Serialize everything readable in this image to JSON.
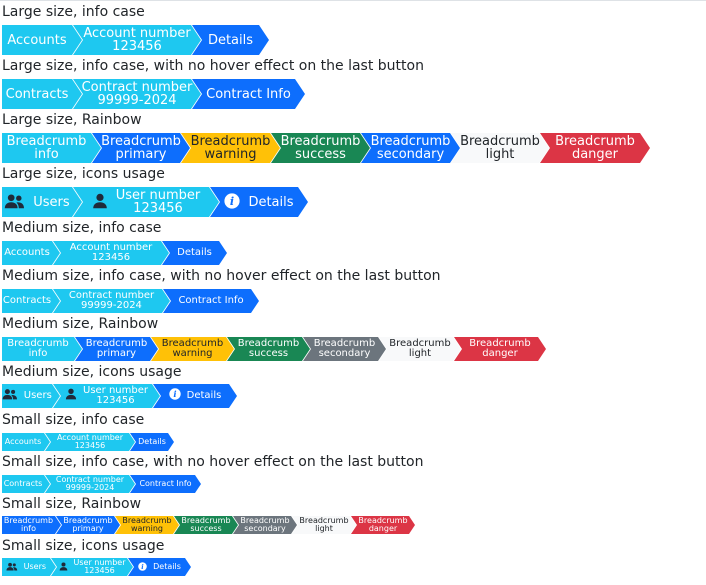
{
  "colors": {
    "info": "#1ec8f0",
    "primary": "#0d6efd",
    "warning": "#ffc107",
    "success": "#198754",
    "secondary": "#6c757d",
    "light": "#f8f9fa",
    "danger": "#dc3545",
    "dark_text": "#212529",
    "white_text": "#ffffff"
  },
  "sections": [
    {
      "heading": "Large size, info case",
      "items": [
        {
          "lines": [
            "Accounts"
          ],
          "color": "info"
        },
        {
          "lines": [
            "Account number",
            "123456"
          ],
          "color": "info"
        },
        {
          "lines": [
            "Details"
          ],
          "color": "primary"
        }
      ]
    },
    {
      "heading": "Large size, info case, with no hover effect on the last button",
      "items": [
        {
          "lines": [
            "Contracts"
          ],
          "color": "info"
        },
        {
          "lines": [
            "Contract number",
            "99999-2024"
          ],
          "color": "info"
        },
        {
          "lines": [
            "Contract Info"
          ],
          "color": "primary"
        }
      ]
    },
    {
      "heading": "Large size, Rainbow",
      "items": [
        {
          "lines": [
            "Breadcrumb",
            "info"
          ],
          "color": "info"
        },
        {
          "lines": [
            "Breadcrumb",
            "primary"
          ],
          "color": "primary"
        },
        {
          "lines": [
            "Breadcrumb",
            "warning"
          ],
          "color": "warning"
        },
        {
          "lines": [
            "Breadcrumb",
            "success"
          ],
          "color": "success"
        },
        {
          "lines": [
            "Breadcrumb",
            "secondary"
          ],
          "color": "primary"
        },
        {
          "lines": [
            "Breadcrumb",
            "light"
          ],
          "color": "light"
        },
        {
          "lines": [
            "Breadcrumb",
            "danger"
          ],
          "color": "danger"
        }
      ]
    },
    {
      "heading": "Large size, icons usage",
      "items": [
        {
          "lines": [
            "Users"
          ],
          "color": "info",
          "icon": "users-icon"
        },
        {
          "lines": [
            "User number",
            "123456"
          ],
          "color": "info",
          "icon": "user-icon"
        },
        {
          "lines": [
            "Details"
          ],
          "color": "primary",
          "icon": "info-icon"
        }
      ]
    },
    {
      "heading": "Medium size, info case",
      "items": [
        {
          "lines": [
            "Accounts"
          ],
          "color": "info"
        },
        {
          "lines": [
            "Account number",
            "123456"
          ],
          "color": "info"
        },
        {
          "lines": [
            "Details"
          ],
          "color": "primary"
        }
      ]
    },
    {
      "heading": "Medium size, info case, with no hover effect on the last button",
      "items": [
        {
          "lines": [
            "Contracts"
          ],
          "color": "info"
        },
        {
          "lines": [
            "Contract number",
            "99999-2024"
          ],
          "color": "info"
        },
        {
          "lines": [
            "Contract Info"
          ],
          "color": "primary"
        }
      ]
    },
    {
      "heading": "Medium size, Rainbow",
      "items": [
        {
          "lines": [
            "Breadcrumb",
            "info"
          ],
          "color": "info"
        },
        {
          "lines": [
            "Breadcrumb",
            "primary"
          ],
          "color": "primary"
        },
        {
          "lines": [
            "Breadcrumb",
            "warning"
          ],
          "color": "warning"
        },
        {
          "lines": [
            "Breadcrumb",
            "success"
          ],
          "color": "success"
        },
        {
          "lines": [
            "Breadcrumb",
            "secondary"
          ],
          "color": "secondary"
        },
        {
          "lines": [
            "Breadcrumb",
            "light"
          ],
          "color": "light"
        },
        {
          "lines": [
            "Breadcrumb",
            "danger"
          ],
          "color": "danger"
        }
      ]
    },
    {
      "heading": "Medium size, icons usage",
      "items": [
        {
          "lines": [
            "Users"
          ],
          "color": "info",
          "icon": "users-icon"
        },
        {
          "lines": [
            "User number",
            "123456"
          ],
          "color": "info",
          "icon": "user-icon"
        },
        {
          "lines": [
            "Details"
          ],
          "color": "primary",
          "icon": "info-icon"
        }
      ]
    },
    {
      "heading": "Small size, info case",
      "items": [
        {
          "lines": [
            "Accounts"
          ],
          "color": "info"
        },
        {
          "lines": [
            "Account number",
            "123456"
          ],
          "color": "info"
        },
        {
          "lines": [
            "Details"
          ],
          "color": "primary"
        }
      ]
    },
    {
      "heading": "Small size, info case, with no hover effect on the last button",
      "items": [
        {
          "lines": [
            "Contracts"
          ],
          "color": "info"
        },
        {
          "lines": [
            "Contract number",
            "99999-2024"
          ],
          "color": "info"
        },
        {
          "lines": [
            "Contract Info"
          ],
          "color": "primary"
        }
      ]
    },
    {
      "heading": "Small size, Rainbow",
      "items": [
        {
          "lines": [
            "Breadcrumb",
            "info"
          ],
          "color": "primary"
        },
        {
          "lines": [
            "Breadcrumb",
            "primary"
          ],
          "color": "primary"
        },
        {
          "lines": [
            "Breadcrumb",
            "warning"
          ],
          "color": "warning"
        },
        {
          "lines": [
            "Breadcrumb",
            "success"
          ],
          "color": "success"
        },
        {
          "lines": [
            "Breadcrumb",
            "secondary"
          ],
          "color": "secondary"
        },
        {
          "lines": [
            "Breadcrumb",
            "light"
          ],
          "color": "light"
        },
        {
          "lines": [
            "Breadcrumb",
            "danger"
          ],
          "color": "danger"
        }
      ]
    },
    {
      "heading": "Small size, icons usage",
      "items": [
        {
          "lines": [
            "Users"
          ],
          "color": "info",
          "icon": "users-icon"
        },
        {
          "lines": [
            "User number",
            "123456"
          ],
          "color": "info",
          "icon": "user-icon"
        },
        {
          "lines": [
            "Details"
          ],
          "color": "primary",
          "icon": "info-icon"
        }
      ]
    }
  ]
}
